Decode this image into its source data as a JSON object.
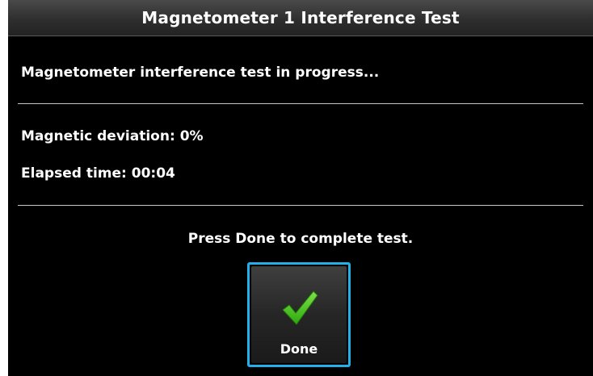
{
  "dialog": {
    "title": "Magnetometer 1 Interference Test",
    "status_message": "Magnetometer interference test in progress...",
    "fields": [
      {
        "label": "Magnetic deviation:",
        "value": "0%"
      },
      {
        "label": "Elapsed time:",
        "value": "00:04"
      }
    ],
    "instruction": "Press Done to complete test.",
    "done_button": {
      "label": "Done",
      "icon": "checkmark-icon"
    }
  },
  "colors": {
    "background": "#000000",
    "text": "#ffffff",
    "title_bar": "#333333",
    "selection_border": "#21b0e8",
    "checkmark": "#3fc21a",
    "divider": "#c8c8c8"
  }
}
